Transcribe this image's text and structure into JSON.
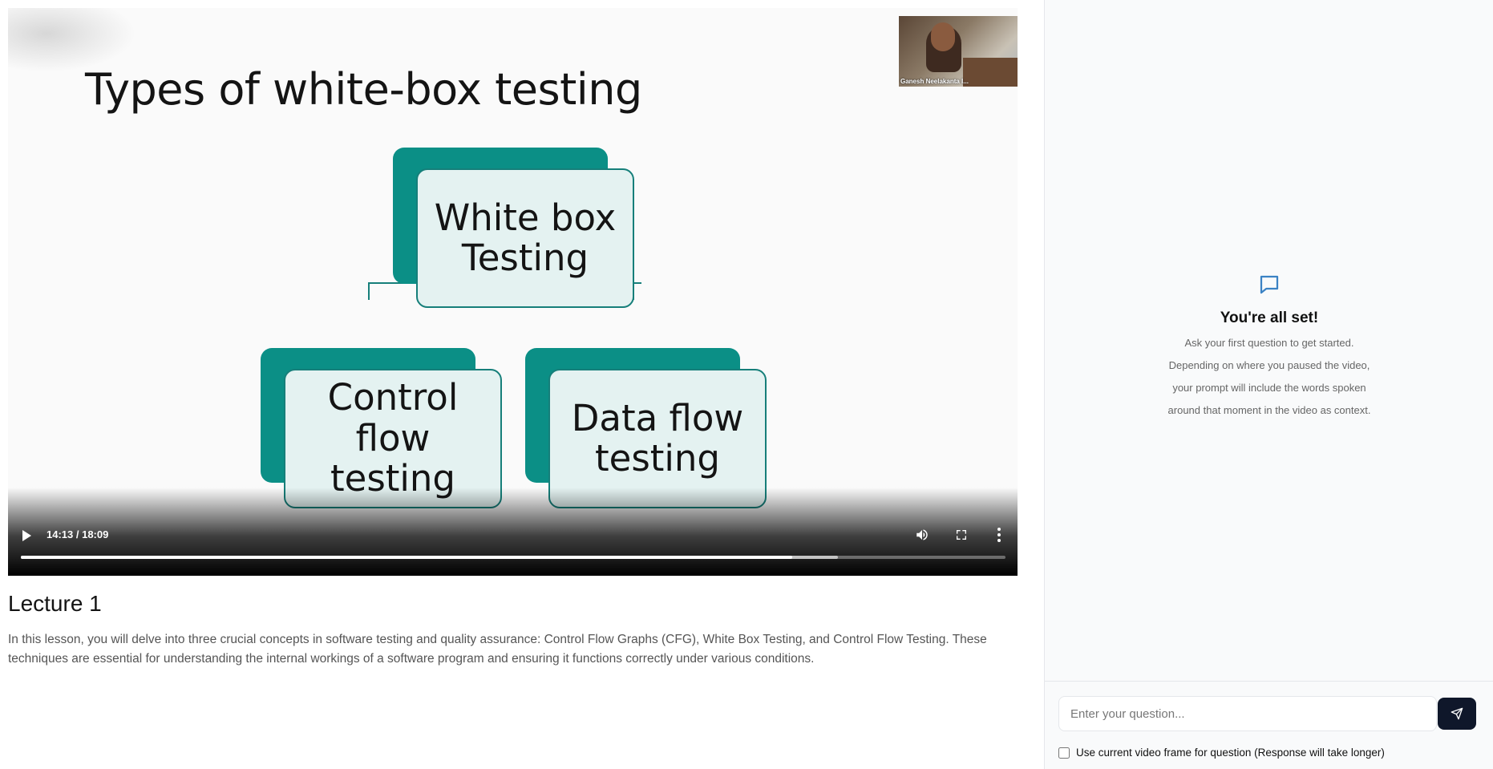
{
  "video": {
    "slide_title": "Types of white-box testing",
    "diagram": {
      "root": "White box Testing",
      "children": [
        "Control flow testing",
        "Data flow testing"
      ]
    },
    "webcam_name": "Ganesh Neelakanta I...",
    "time_display": "14:13 / 18:09",
    "progress_fraction": 0.783,
    "buffered_fraction": 0.83
  },
  "lecture": {
    "title": "Lecture 1",
    "description": "In this lesson, you will delve into three crucial concepts in software testing and quality assurance: Control Flow Graphs (CFG), White Box Testing, and Control Flow Testing. These techniques are essential for understanding the internal workings of a software program and ensuring it functions correctly under various conditions."
  },
  "chat": {
    "empty_title": "You're all set!",
    "empty_line1": "Ask your first question to get started.",
    "empty_line2": "Depending on where you paused the video,",
    "empty_line3": "your prompt will include the words spoken",
    "empty_line4": "around that moment in the video as context.",
    "input_placeholder": "Enter your question...",
    "checkbox_label": "Use current video frame for question (Response will take longer)"
  },
  "colors": {
    "teal": "#0b8f86",
    "box_fill": "#e4f2f1",
    "send_button": "#0f172a",
    "chat_icon": "#3b82c4"
  }
}
